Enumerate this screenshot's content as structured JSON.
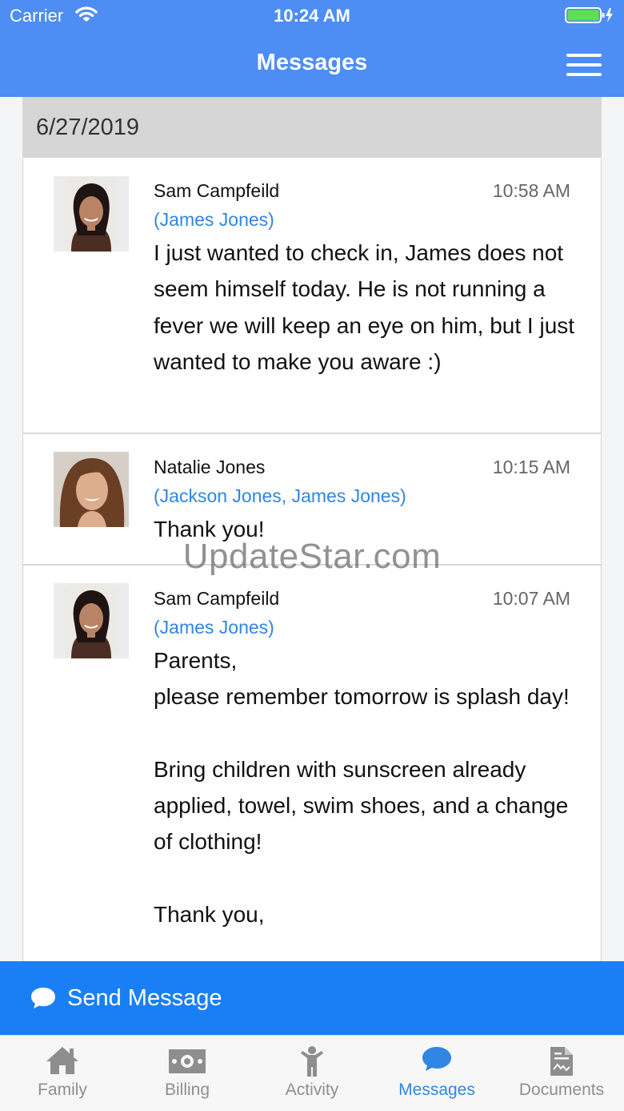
{
  "status": {
    "carrier": "Carrier",
    "time": "10:24 AM"
  },
  "navbar": {
    "title": "Messages"
  },
  "date_header": "6/27/2019",
  "messages": [
    {
      "sender": "Sam Campfeild",
      "time": "10:58 AM",
      "children": "(James Jones)",
      "body": "I just wanted to check in, James does not seem himself today. He is not running a fever we will keep an eye on him, but I just wanted to make you aware :)"
    },
    {
      "sender": "Natalie Jones",
      "time": "10:15 AM",
      "children": "(Jackson Jones, James Jones)",
      "body": "Thank you!"
    },
    {
      "sender": "Sam Campfeild",
      "time": "10:07 AM",
      "children": "(James Jones)",
      "body": "Parents,\nplease remember tomorrow is splash day!\n\nBring children with sunscreen already applied, towel, swim shoes, and a change of clothing!\n\nThank you,"
    }
  ],
  "watermark": "UpdateStar.com",
  "send": {
    "label": "Send Message"
  },
  "tabs": [
    {
      "label": "Family",
      "icon": "home-icon"
    },
    {
      "label": "Billing",
      "icon": "money-icon"
    },
    {
      "label": "Activity",
      "icon": "person-icon"
    },
    {
      "label": "Messages",
      "icon": "chat-icon"
    },
    {
      "label": "Documents",
      "icon": "document-icon"
    }
  ],
  "colors": {
    "header": "#4d8df4",
    "send_bar": "#1a7ff4",
    "link": "#2f86e3",
    "tab_inactive": "#8e8e8e"
  }
}
